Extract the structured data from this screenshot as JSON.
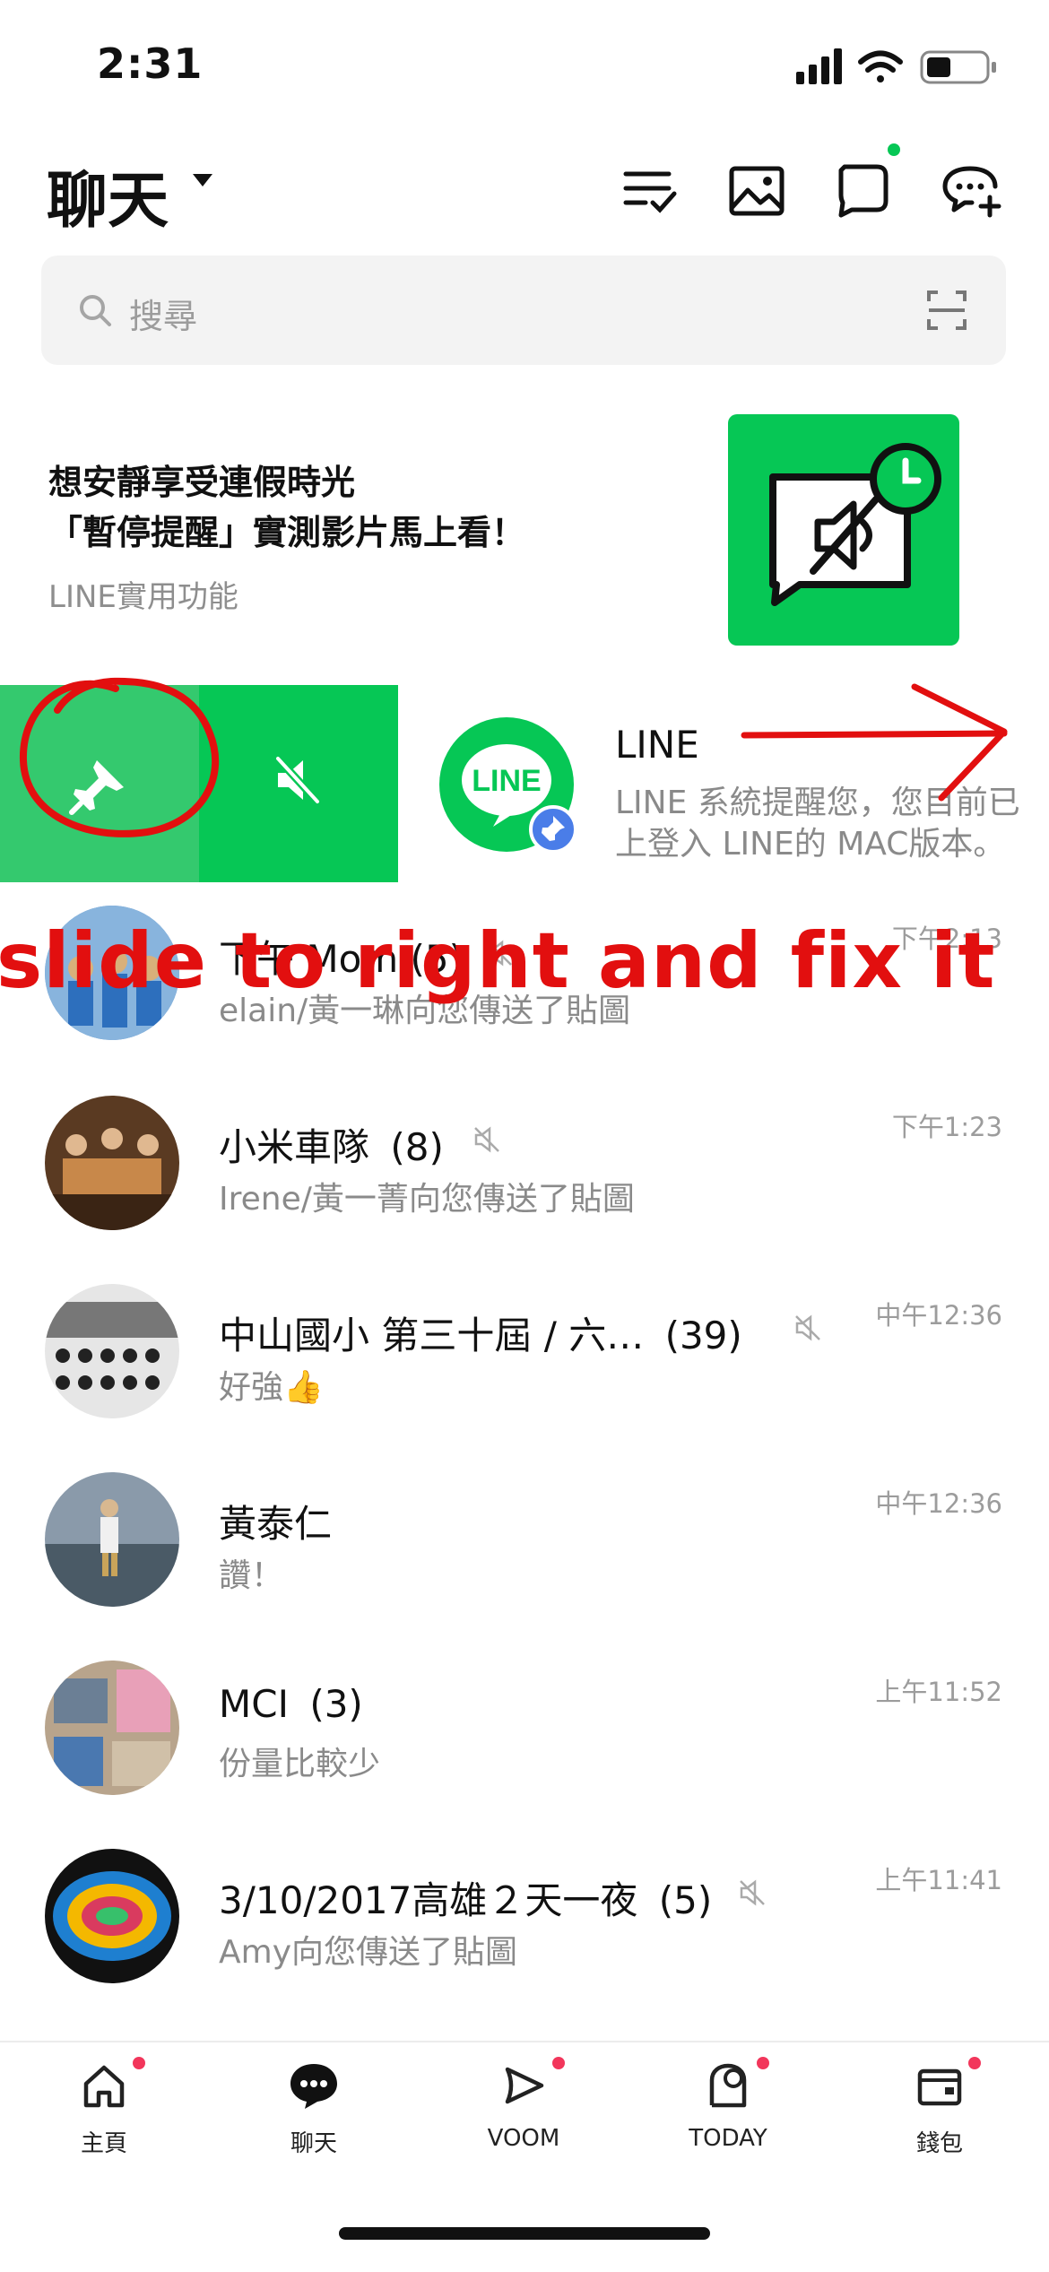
{
  "status_bar": {
    "time": "2:31"
  },
  "header": {
    "title": "聊天"
  },
  "search": {
    "placeholder": "搜尋"
  },
  "banner": {
    "title": "想安靜享受連假時光\n「暫停提醒」實測影片馬上看！",
    "subtitle": "LINE實用功能"
  },
  "swipe_actions": {
    "pin_icon": "pin-icon",
    "mute_icon": "mute-icon"
  },
  "annotation": {
    "text": "slide to right and fix it"
  },
  "chats": [
    {
      "name": "LINE",
      "preview_1": "LINE 系統提醒您，您目前已",
      "preview_2": "上登入 LINE的 MAC版本。",
      "avatar_text": "LINE",
      "pinned": true
    },
    {
      "name": "下午 Mom (5)",
      "preview": "elain/黃一琳向您傳送了貼圖",
      "time": "下午2:13",
      "muted": true
    },
    {
      "name": "小米車隊",
      "count": "(8)",
      "preview": "Irene/黃一菁向您傳送了貼圖",
      "time": "下午1:23",
      "muted": true
    },
    {
      "name": "中山國小 第三十屆 / 六…",
      "count": "(39)",
      "preview": "好強👍",
      "time": "中午12:36",
      "muted": true
    },
    {
      "name": "黃泰仁",
      "count": "",
      "preview": "讚！",
      "time": "中午12:36",
      "muted": false
    },
    {
      "name": "MCI",
      "count": "(3)",
      "preview": "份量比較少",
      "time": "上午11:52",
      "muted": false
    },
    {
      "name": "3/10/2017高雄２天一夜",
      "count": "(5)",
      "preview": "Amy向您傳送了貼圖",
      "time": "上午11:41",
      "muted": true
    }
  ],
  "tabs": [
    {
      "label": "主頁",
      "icon": "home-icon",
      "badge": true
    },
    {
      "label": "聊天",
      "icon": "chat-bubble-icon",
      "badge": false
    },
    {
      "label": "VOOM",
      "icon": "voom-icon",
      "badge": true
    },
    {
      "label": "TODAY",
      "icon": "today-icon",
      "badge": true
    },
    {
      "label": "錢包",
      "icon": "wallet-icon",
      "badge": true
    }
  ],
  "colors": {
    "line_green": "#06c755",
    "pin_green": "#34c96e",
    "annotation_red": "#e20f0f",
    "badge_red": "#f2365b"
  }
}
